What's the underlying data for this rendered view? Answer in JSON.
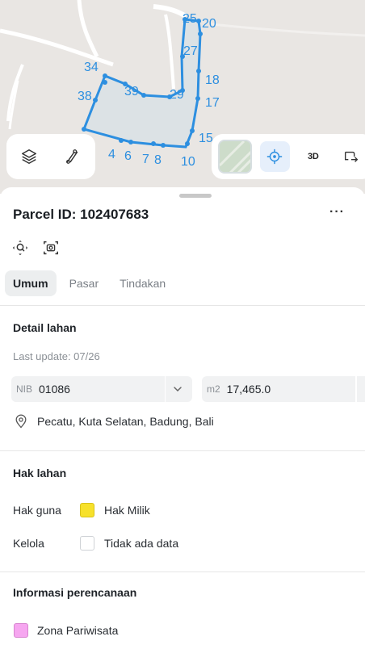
{
  "map": {
    "parcel_labels": [
      "25",
      "20",
      "27",
      "34",
      "18",
      "39",
      "29",
      "38",
      "17",
      "15",
      "4",
      "6",
      "7",
      "8",
      "10"
    ],
    "three_d_label": "3D",
    "icons": [
      "layers-icon",
      "route-icon",
      "satellite-thumbnail",
      "locate-icon",
      "share-icon"
    ]
  },
  "parcel": {
    "title": "Parcel ID: 102407683",
    "more_label": "···"
  },
  "tabs": [
    {
      "label": "Umum",
      "active": true
    },
    {
      "label": "Pasar",
      "active": false
    },
    {
      "label": "Tindakan",
      "active": false
    }
  ],
  "detail": {
    "heading": "Detail lahan",
    "last_update": "Last update: 07/26",
    "nib_prefix": "NIB",
    "nib_value": "01086",
    "area_prefix": "m2",
    "area_value": "17,465.0",
    "location": "Pecatu, Kuta Selatan, Badung, Bali"
  },
  "hak": {
    "heading": "Hak lahan",
    "rows": [
      {
        "label": "Hak guna",
        "value": "Hak Milik",
        "color": "#f7e12b"
      },
      {
        "label": "Kelola",
        "value": "Tidak ada data",
        "color": "#ffffff"
      }
    ]
  },
  "planning": {
    "heading": "Informasi perencanaan",
    "zone_label": "Zona Pariwisata",
    "zone_color": "#f6a6f0"
  },
  "colors": {
    "accent": "#2d8fe0",
    "tab_active_bg": "#eceeef"
  }
}
